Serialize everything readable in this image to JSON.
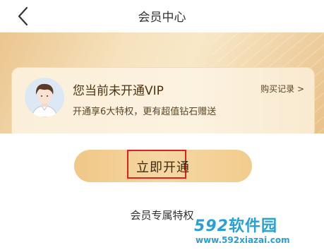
{
  "header": {
    "title": "会员中心",
    "back_icon": "chevron-left-icon"
  },
  "membership_card": {
    "status_title": "您当前未开通VIP",
    "status_subtitle": "开通享6大特权，更有超值钻石赠送",
    "purchase_record_link": "购买记录 >",
    "avatar_icon": "user-avatar-icon"
  },
  "actions": {
    "open_button_label": "立即开通"
  },
  "section": {
    "title": "会员专属特权"
  },
  "watermark": {
    "logo_digits": "592",
    "logo_text": "软件园",
    "url": "www.592xiazai.com"
  },
  "colors": {
    "banner_gold": "#ebc58e",
    "button_gold": "#f0c787",
    "highlight_red": "#e02020",
    "watermark_blue": "#2a9fd6"
  }
}
